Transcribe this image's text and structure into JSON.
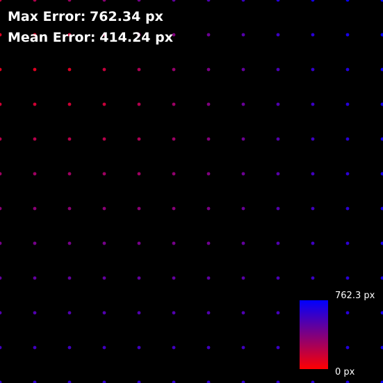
{
  "stats": {
    "max_label": "Max Error:",
    "max_value": "762.34 px",
    "mean_label": "Mean Error:",
    "mean_value": "414.24 px"
  },
  "colorbar": {
    "max_label": "762.3 px",
    "min_label": "0 px",
    "color_low": "#ff0000",
    "color_high": "#0000ff"
  },
  "chart_data": {
    "type": "scatter",
    "title": "",
    "xlabel": "",
    "ylabel": "",
    "x": [
      0,
      1,
      2,
      3,
      4,
      5,
      6,
      7,
      8,
      9,
      10,
      11
    ],
    "y": [
      0,
      1,
      2,
      3,
      4,
      5,
      6,
      7,
      8,
      9,
      10,
      11
    ],
    "value_unit": "px",
    "value_range": [
      0,
      762.34
    ],
    "values": [
      [
        180,
        230,
        290,
        350,
        410,
        470,
        530,
        590,
        650,
        700,
        740,
        762
      ],
      [
        100,
        110,
        160,
        230,
        300,
        370,
        440,
        510,
        580,
        640,
        690,
        740
      ],
      [
        100,
        100,
        110,
        180,
        250,
        320,
        400,
        470,
        540,
        610,
        660,
        720
      ],
      [
        150,
        150,
        150,
        170,
        230,
        300,
        380,
        450,
        520,
        590,
        650,
        700
      ],
      [
        220,
        220,
        220,
        220,
        250,
        300,
        370,
        440,
        510,
        580,
        640,
        700
      ],
      [
        290,
        290,
        290,
        290,
        290,
        330,
        380,
        440,
        500,
        570,
        630,
        690
      ],
      [
        350,
        350,
        350,
        350,
        350,
        360,
        400,
        450,
        510,
        570,
        630,
        690
      ],
      [
        410,
        410,
        410,
        410,
        410,
        410,
        430,
        470,
        520,
        580,
        630,
        690
      ],
      [
        470,
        470,
        470,
        470,
        470,
        470,
        480,
        500,
        540,
        590,
        640,
        690
      ],
      [
        520,
        520,
        520,
        520,
        520,
        520,
        520,
        530,
        560,
        600,
        650,
        700
      ],
      [
        570,
        570,
        570,
        570,
        570,
        570,
        570,
        570,
        590,
        620,
        660,
        710
      ],
      [
        620,
        620,
        620,
        620,
        620,
        620,
        620,
        620,
        620,
        640,
        680,
        720
      ]
    ]
  }
}
